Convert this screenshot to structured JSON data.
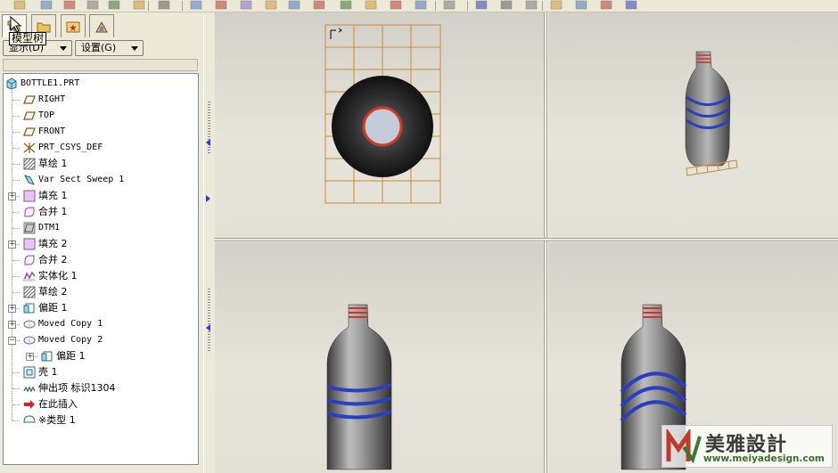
{
  "navigator": {
    "tooltip": "模型树",
    "tabs": [
      "model-tree",
      "folder-browser",
      "favorites",
      "connections"
    ],
    "show_label": "显示(D)",
    "settings_label": "设置(G)"
  },
  "tree": {
    "root": "BOTTLE1.PRT",
    "items": [
      {
        "label": "RIGHT",
        "icon": "datum-plane-icon",
        "expandable": false
      },
      {
        "label": "TOP",
        "icon": "datum-plane-icon",
        "expandable": false
      },
      {
        "label": "FRONT",
        "icon": "datum-plane-icon",
        "expandable": false
      },
      {
        "label": "PRT_CSYS_DEF",
        "icon": "csys-icon",
        "expandable": false
      },
      {
        "label": "草绘 1",
        "icon": "sketch-icon",
        "expandable": false
      },
      {
        "label": "Var Sect Sweep 1",
        "icon": "sweep-icon",
        "expandable": false
      },
      {
        "label": "填充 1",
        "icon": "fill-icon",
        "expandable": true,
        "expanded": false
      },
      {
        "label": "合并 1",
        "icon": "merge-icon",
        "expandable": false
      },
      {
        "label": "DTM1",
        "icon": "datum-plane-gray-icon",
        "expandable": false
      },
      {
        "label": "填充 2",
        "icon": "fill-icon",
        "expandable": true,
        "expanded": false
      },
      {
        "label": "合并 2",
        "icon": "merge-icon",
        "expandable": false
      },
      {
        "label": "实体化 1",
        "icon": "solidify-icon",
        "expandable": false
      },
      {
        "label": "草绘 2",
        "icon": "sketch-icon",
        "expandable": false
      },
      {
        "label": "偏距 1",
        "icon": "offset-icon",
        "expandable": true,
        "expanded": false
      },
      {
        "label": "Moved Copy 1",
        "icon": "moved-copy-icon",
        "expandable": true,
        "expanded": false
      },
      {
        "label": "Moved Copy 2",
        "icon": "moved-copy-icon",
        "expandable": true,
        "expanded": true
      },
      {
        "label": "偏距 1",
        "icon": "offset-icon",
        "expandable": true,
        "expanded": false,
        "child": true
      },
      {
        "label": "壳 1",
        "icon": "shell-icon",
        "expandable": false
      },
      {
        "label": "伸出项 标识1304",
        "icon": "protrusion-icon",
        "expandable": false
      },
      {
        "label": "在此插入",
        "icon": "insert-here-icon",
        "expandable": false
      },
      {
        "label": "※类型 1",
        "icon": "style-icon",
        "expandable": false
      }
    ]
  },
  "viewports": [
    {
      "name": "top-view",
      "content": "bottle top view with sketch grid"
    },
    {
      "name": "isometric-view",
      "content": "bottle isometric view"
    },
    {
      "name": "front-view",
      "content": "bottle front view"
    },
    {
      "name": "right-view",
      "content": "bottle side view"
    }
  ],
  "watermark": {
    "brand": "美雅設計",
    "url": "www.meiyadesign.com"
  },
  "colors": {
    "bottle_body": "#8a8a8a",
    "bottle_bands": "#2a3fc0",
    "neck_threads": "#c8372c",
    "grid": "#c88a3a",
    "viewport_bg": "#e3e1d6"
  }
}
